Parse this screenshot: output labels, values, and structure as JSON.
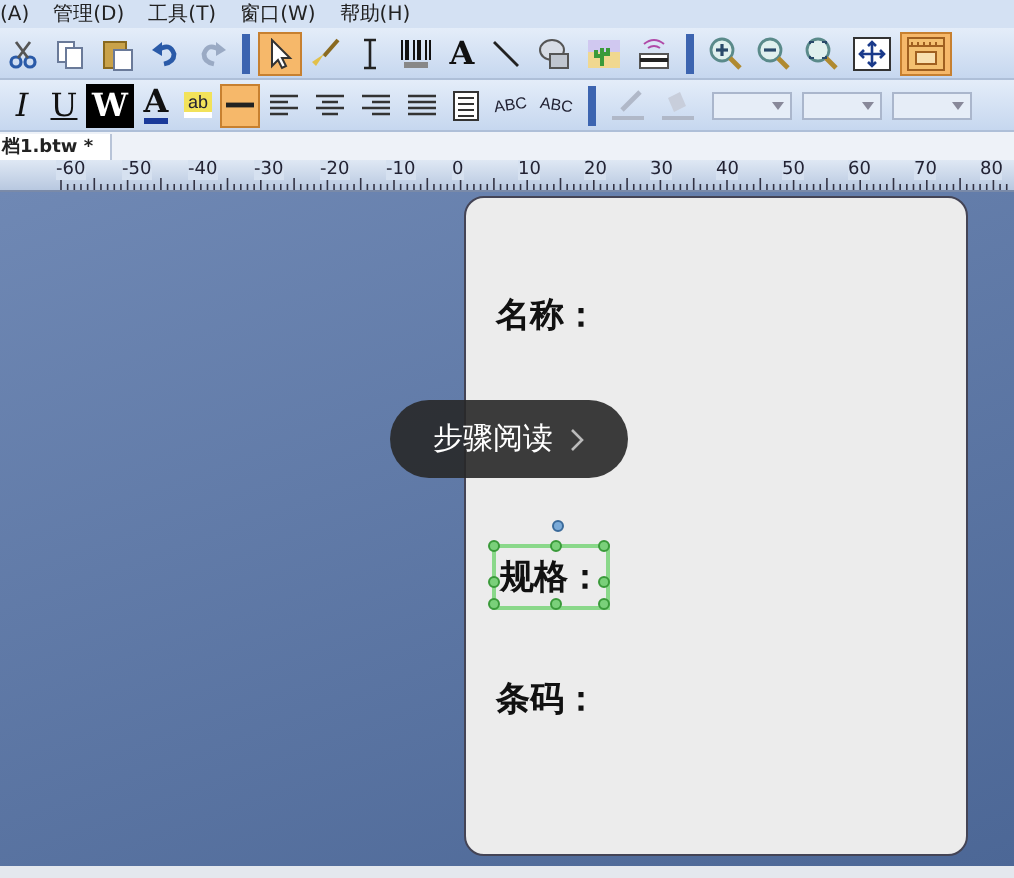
{
  "menu_bar": {
    "items": [
      "(A)",
      "管理(D)",
      "工具(T)",
      "窗口(W)",
      "帮助(H)"
    ]
  },
  "toolbar_1": [
    {
      "kind": "cut",
      "selected": false
    },
    {
      "kind": "copy",
      "selected": false
    },
    {
      "kind": "paste",
      "selected": false
    },
    {
      "kind": "undo",
      "selected": false
    },
    {
      "kind": "redo",
      "selected": false
    },
    {
      "kind": "sep"
    },
    {
      "kind": "pointer",
      "selected": true
    },
    {
      "kind": "brush",
      "selected": false
    },
    {
      "kind": "cursor",
      "selected": false
    },
    {
      "kind": "barcode",
      "selected": false
    },
    {
      "kind": "letter",
      "label": "A",
      "selected": false
    },
    {
      "kind": "line",
      "selected": false
    },
    {
      "kind": "shape",
      "selected": false
    },
    {
      "kind": "image",
      "selected": false
    },
    {
      "kind": "card",
      "selected": false
    },
    {
      "kind": "sep"
    },
    {
      "kind": "zoomin",
      "selected": false
    },
    {
      "kind": "zoomout",
      "selected": false
    },
    {
      "kind": "zoomfit",
      "selected": false
    },
    {
      "kind": "fitall",
      "selected": false
    },
    {
      "kind": "layout",
      "selected": true
    }
  ],
  "toolbar_2": [
    {
      "kind": "italic",
      "label": "I",
      "selected": false
    },
    {
      "kind": "underline",
      "label": "U",
      "selected": false
    },
    {
      "kind": "inverse",
      "label": "W",
      "selected": false
    },
    {
      "kind": "color",
      "label": "A",
      "selected": false
    },
    {
      "kind": "highlight",
      "label": "ab",
      "selected": false
    },
    {
      "kind": "hline",
      "selected": true
    },
    {
      "kind": "alignleft",
      "selected": false
    },
    {
      "kind": "aligncenter",
      "selected": false
    },
    {
      "kind": "alignright",
      "selected": false
    },
    {
      "kind": "justify",
      "selected": false
    },
    {
      "kind": "wrap",
      "selected": false
    },
    {
      "kind": "arc",
      "label": "ABC",
      "selected": false
    },
    {
      "kind": "wave",
      "label": "ABC",
      "selected": false
    },
    {
      "kind": "sep"
    },
    {
      "kind": "pen",
      "selected": false
    },
    {
      "kind": "fill",
      "selected": false
    },
    {
      "kind": "dropdown"
    },
    {
      "kind": "dropdown"
    },
    {
      "kind": "dropdown"
    }
  ],
  "tab": {
    "label": "档1.btw *"
  },
  "ruler": {
    "labels": [
      "-60",
      "-50",
      "-40",
      "-30",
      "-20",
      "-10",
      "0",
      "10",
      "20",
      "30",
      "40",
      "50",
      "60",
      "70",
      "80"
    ]
  },
  "label_fields": [
    {
      "text": "名称：",
      "selected": false
    },
    {
      "text": "规格：",
      "selected": true
    },
    {
      "text": "条码：",
      "selected": false
    }
  ],
  "overlay_button": {
    "label": "步骤阅读"
  }
}
